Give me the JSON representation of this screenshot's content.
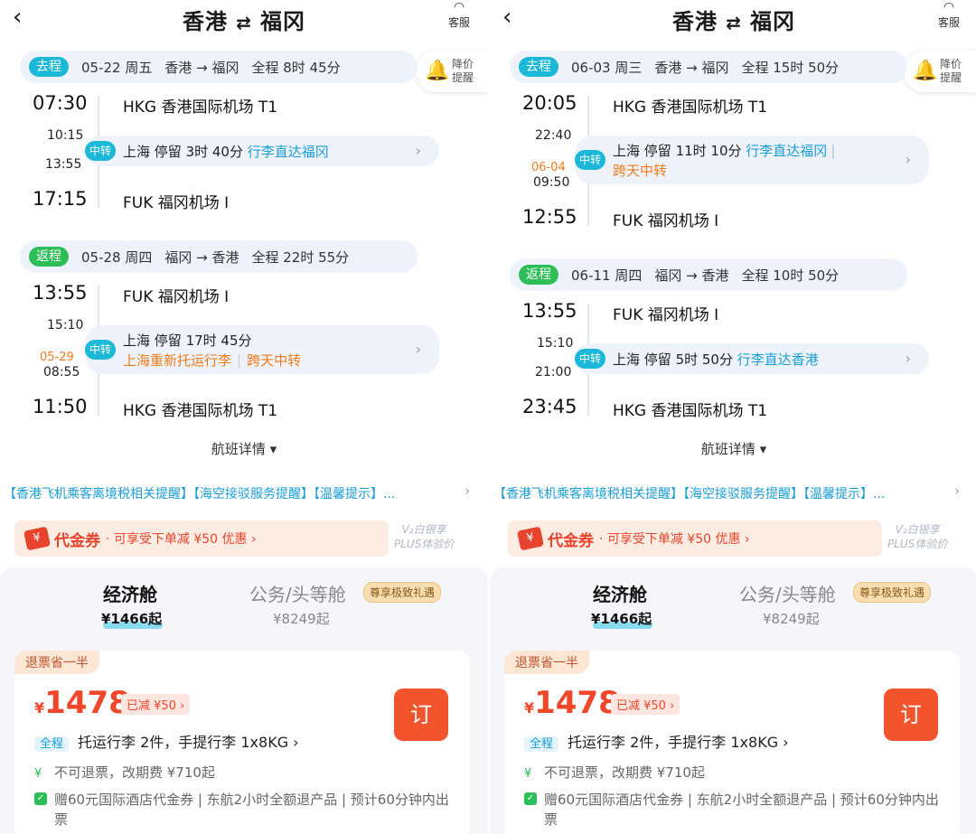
{
  "panels": [
    {
      "header": {
        "back_icon": "‹",
        "from": "香港",
        "arrow": "⇄",
        "to": "福冈",
        "service_label": "客服"
      },
      "price_alert": {
        "line1": "降价",
        "line2": "提醒"
      },
      "outbound": {
        "tag": "去程",
        "date": "05-22 周五",
        "route": "香港 → 福冈",
        "duration": "全程 8时 45分",
        "dep_time": "07:30",
        "dep_airport": "HKG 香港国际机场 T1",
        "transfer": {
          "badge": "中转",
          "arr_time": "10:15",
          "arr_date": "",
          "dep_time": "13:55",
          "city": "上海",
          "stay": "停留 3时 40分",
          "baggage": "行李直达福冈",
          "line2a": "",
          "line2b": ""
        },
        "arr_time": "17:15",
        "arr_airport": "FUK 福冈机场 I"
      },
      "return": {
        "tag": "返程",
        "date": "05-28 周四",
        "route": "福冈 → 香港",
        "duration": "全程 22时 55分",
        "dep_time": "13:55",
        "dep_airport": "FUK 福冈机场 I",
        "transfer": {
          "badge": "中转",
          "arr_time": "15:10",
          "arr_date": "05-29",
          "dep_time": "08:55",
          "city": "上海",
          "stay": "停留 17时 45分",
          "baggage": "",
          "line2a": "上海重新托运行李",
          "line2b": "跨天中转"
        },
        "arr_time": "11:50",
        "arr_airport": "HKG 香港国际机场 T1"
      },
      "flight_detail": "航班详情 ▾",
      "notice": "【香港飞机乘客离境税相关提醒】【海空接驳服务提醒】【温馨提示】...",
      "coupon": {
        "name": "代金券",
        "desc": "· 可享受下单减 ¥50 优惠  ›"
      },
      "plus": {
        "line1": "V₂白银享",
        "line2": "PLUS体验价"
      },
      "cabins": {
        "eco_label": "经济舱",
        "eco_price": "¥1466起",
        "biz_label": "公务/头等舱",
        "biz_tag": "尊享极致礼遇",
        "biz_price": "¥8249起"
      },
      "card": {
        "refund_tag": "退票省一半",
        "yen": "¥",
        "price": "1478",
        "discount": "已减  ¥50 ›",
        "book": "订",
        "bag_tag": "全程",
        "bag_text": "托运行李 2件，手提行李 1x8KG ›",
        "rule": "不可退票，改期费 ¥710起",
        "gift": "赠60元国际酒店代金券 | 东航2小时全额退产品 | 预计60分钟内出票"
      }
    },
    {
      "header": {
        "back_icon": "‹",
        "from": "香港",
        "arrow": "⇄",
        "to": "福冈",
        "service_label": "客服"
      },
      "price_alert": {
        "line1": "降价",
        "line2": "提醒"
      },
      "outbound": {
        "tag": "去程",
        "date": "06-03 周三",
        "route": "香港 → 福冈",
        "duration": "全程 15时 50分",
        "dep_time": "20:05",
        "dep_airport": "HKG 香港国际机场 T1",
        "transfer": {
          "badge": "中转",
          "arr_time": "22:40",
          "arr_date": "06-04",
          "dep_time": "09:50",
          "city": "上海",
          "stay": "停留 11时 10分",
          "baggage": "行李直达福冈",
          "line2a": "跨天中转",
          "line2b": ""
        },
        "arr_time": "12:55",
        "arr_airport": "FUK 福冈机场 I"
      },
      "return": {
        "tag": "返程",
        "date": "06-11 周四",
        "route": "福冈 → 香港",
        "duration": "全程 10时 50分",
        "dep_time": "13:55",
        "dep_airport": "FUK 福冈机场 I",
        "transfer": {
          "badge": "中转",
          "arr_time": "15:10",
          "arr_date": "",
          "dep_time": "21:00",
          "city": "上海",
          "stay": "停留 5时 50分",
          "baggage": "行李直达香港",
          "line2a": "",
          "line2b": ""
        },
        "arr_time": "23:45",
        "arr_airport": "HKG 香港国际机场 T1"
      },
      "flight_detail": "航班详情 ▾",
      "notice": "【香港飞机乘客离境税相关提醒】【海空接驳服务提醒】【温馨提示】...",
      "coupon": {
        "name": "代金券",
        "desc": "· 可享受下单减 ¥50 优惠  ›"
      },
      "plus": {
        "line1": "V₂白银享",
        "line2": "PLUS体验价"
      },
      "cabins": {
        "eco_label": "经济舱",
        "eco_price": "¥1466起",
        "biz_label": "公务/头等舱",
        "biz_tag": "尊享极致礼遇",
        "biz_price": "¥8249起"
      },
      "card": {
        "refund_tag": "退票省一半",
        "yen": "¥",
        "price": "1478",
        "discount": "已减  ¥50 ›",
        "book": "订",
        "bag_tag": "全程",
        "bag_text": "托运行李 2件，手提行李 1x8KG ›",
        "rule": "不可退票，改期费 ¥710起",
        "gift": "赠60元国际酒店代金券 | 东航2小时全额退产品 | 预计60分钟内出票"
      }
    }
  ],
  "colors": {
    "accent_blue": "#1cb8d8",
    "return_green": "#2dbe58",
    "price_red": "#f0462a",
    "orange": "#f07b1c"
  }
}
